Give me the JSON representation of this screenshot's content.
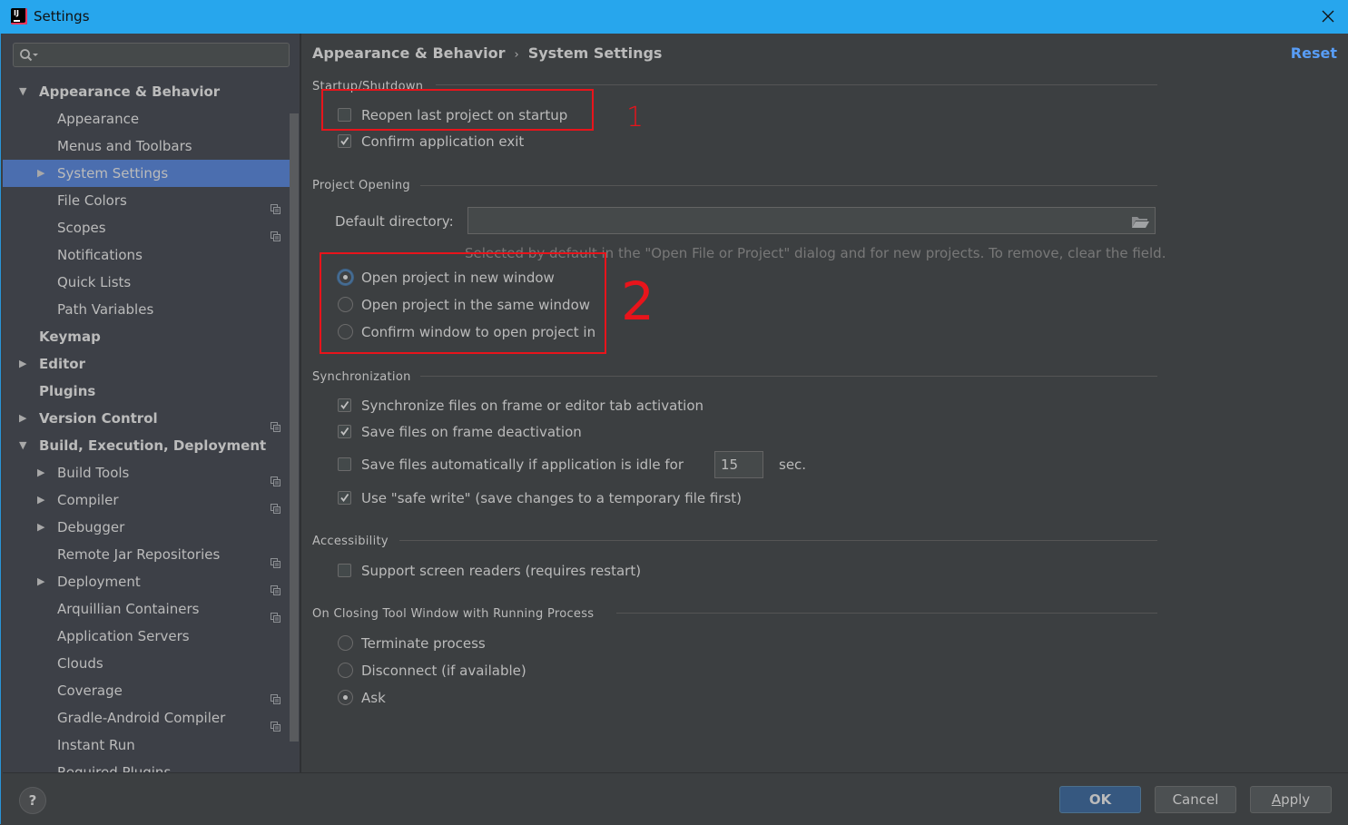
{
  "window": {
    "title": "Settings",
    "app_icon": "intellij-icon",
    "app_icon_text": "IJ"
  },
  "sidebar": {
    "search": {
      "value": "",
      "placeholder": ""
    },
    "items": [
      {
        "label": "Appearance & Behavior",
        "level": 0,
        "bold": true,
        "arrow": "expanded",
        "project_icon": false,
        "selected": false
      },
      {
        "label": "Appearance",
        "level": 1,
        "bold": false,
        "arrow": "none",
        "project_icon": false,
        "selected": false
      },
      {
        "label": "Menus and Toolbars",
        "level": 1,
        "bold": false,
        "arrow": "none",
        "project_icon": false,
        "selected": false
      },
      {
        "label": "System Settings",
        "level": 1,
        "bold": false,
        "arrow": "collapsed",
        "project_icon": false,
        "selected": true
      },
      {
        "label": "File Colors",
        "level": 1,
        "bold": false,
        "arrow": "none",
        "project_icon": true,
        "selected": false
      },
      {
        "label": "Scopes",
        "level": 1,
        "bold": false,
        "arrow": "none",
        "project_icon": true,
        "selected": false
      },
      {
        "label": "Notifications",
        "level": 1,
        "bold": false,
        "arrow": "none",
        "project_icon": false,
        "selected": false
      },
      {
        "label": "Quick Lists",
        "level": 1,
        "bold": false,
        "arrow": "none",
        "project_icon": false,
        "selected": false
      },
      {
        "label": "Path Variables",
        "level": 1,
        "bold": false,
        "arrow": "none",
        "project_icon": false,
        "selected": false
      },
      {
        "label": "Keymap",
        "level": 0,
        "bold": true,
        "arrow": "none",
        "project_icon": false,
        "selected": false
      },
      {
        "label": "Editor",
        "level": 0,
        "bold": true,
        "arrow": "collapsed",
        "project_icon": false,
        "selected": false
      },
      {
        "label": "Plugins",
        "level": 0,
        "bold": true,
        "arrow": "none",
        "project_icon": false,
        "selected": false
      },
      {
        "label": "Version Control",
        "level": 0,
        "bold": true,
        "arrow": "collapsed",
        "project_icon": true,
        "selected": false
      },
      {
        "label": "Build, Execution, Deployment",
        "level": 0,
        "bold": true,
        "arrow": "expanded",
        "project_icon": false,
        "selected": false
      },
      {
        "label": "Build Tools",
        "level": 1,
        "bold": false,
        "arrow": "collapsed",
        "project_icon": true,
        "selected": false
      },
      {
        "label": "Compiler",
        "level": 1,
        "bold": false,
        "arrow": "collapsed",
        "project_icon": true,
        "selected": false
      },
      {
        "label": "Debugger",
        "level": 1,
        "bold": false,
        "arrow": "collapsed",
        "project_icon": false,
        "selected": false
      },
      {
        "label": "Remote Jar Repositories",
        "level": 1,
        "bold": false,
        "arrow": "none",
        "project_icon": true,
        "selected": false
      },
      {
        "label": "Deployment",
        "level": 1,
        "bold": false,
        "arrow": "collapsed",
        "project_icon": true,
        "selected": false
      },
      {
        "label": "Arquillian Containers",
        "level": 1,
        "bold": false,
        "arrow": "none",
        "project_icon": true,
        "selected": false
      },
      {
        "label": "Application Servers",
        "level": 1,
        "bold": false,
        "arrow": "none",
        "project_icon": false,
        "selected": false
      },
      {
        "label": "Clouds",
        "level": 1,
        "bold": false,
        "arrow": "none",
        "project_icon": false,
        "selected": false
      },
      {
        "label": "Coverage",
        "level": 1,
        "bold": false,
        "arrow": "none",
        "project_icon": true,
        "selected": false
      },
      {
        "label": "Gradle-Android Compiler",
        "level": 1,
        "bold": false,
        "arrow": "none",
        "project_icon": true,
        "selected": false
      },
      {
        "label": "Instant Run",
        "level": 1,
        "bold": false,
        "arrow": "none",
        "project_icon": false,
        "selected": false
      },
      {
        "label": "Required Plugins",
        "level": 1,
        "bold": false,
        "arrow": "none",
        "project_icon": true,
        "selected": false
      }
    ]
  },
  "main": {
    "breadcrumb": [
      "Appearance & Behavior",
      "System Settings"
    ],
    "breadcrumb_separator": "›",
    "reset_label": "Reset",
    "startup": {
      "title": "Startup/Shutdown",
      "reopen_last_project": {
        "label": "Reopen last project on startup",
        "checked": false
      },
      "confirm_exit": {
        "label": "Confirm application exit",
        "checked": true
      }
    },
    "project_opening": {
      "title": "Project Opening",
      "default_directory_label": "Default directory:",
      "default_directory_value": "",
      "hint": "Selected by default in the \"Open File or Project\" dialog and for new projects. To remove, clear the field.",
      "options": [
        {
          "label": "Open project in new window",
          "checked": true
        },
        {
          "label": "Open project in the same window",
          "checked": false
        },
        {
          "label": "Confirm window to open project in",
          "checked": false
        }
      ]
    },
    "synchronization": {
      "title": "Synchronization",
      "sync_on_activation": {
        "label": "Synchronize files on frame or editor tab activation",
        "checked": true
      },
      "save_on_deactivation": {
        "label": "Save files on frame deactivation",
        "checked": true
      },
      "save_when_idle": {
        "label": "Save files automatically if application is idle for",
        "checked": false,
        "value": "15",
        "unit": "sec."
      },
      "safe_write": {
        "label": "Use \"safe write\" (save changes to a temporary file first)",
        "checked": true
      }
    },
    "accessibility": {
      "title": "Accessibility",
      "screen_readers": {
        "label": "Support screen readers (requires restart)",
        "checked": false
      }
    },
    "closing_tool_window": {
      "title": "On Closing Tool Window with Running Process",
      "options": [
        {
          "label": "Terminate process",
          "checked": false
        },
        {
          "label": "Disconnect (if available)",
          "checked": false
        },
        {
          "label": "Ask",
          "checked": true
        }
      ]
    }
  },
  "annotations": {
    "one": "1",
    "two": "2",
    "color": "#e8141b"
  },
  "footer": {
    "help_label": "?",
    "ok_label": "OK",
    "cancel_label": "Cancel",
    "apply_label_mnemonic": "A",
    "apply_label_rest": "pply"
  },
  "colors": {
    "titlebar": "#27a6ed",
    "selection": "#4b6eaf",
    "link": "#589df6",
    "background": "#3c3f41",
    "ok_button": "#365880"
  }
}
